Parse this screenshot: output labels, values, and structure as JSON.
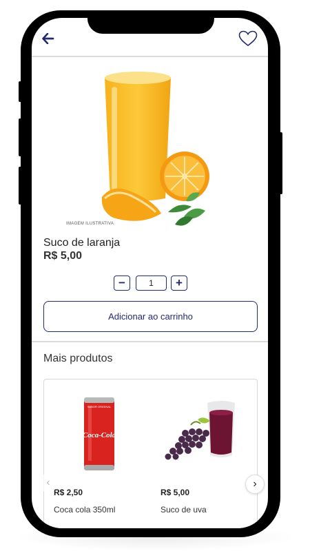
{
  "header": {
    "back_icon": "arrow-left-icon",
    "favorite_icon": "heart-outline-icon",
    "accent_color": "#222a6e"
  },
  "product": {
    "image_caption": "IMAGEM ILUSTRATIVA",
    "name": "Suco de laranja",
    "price": "R$ 5,00"
  },
  "quantity": {
    "minus_label": "−",
    "value": "1",
    "plus_label": "+"
  },
  "add_to_cart_label": "Adicionar ao carrinho",
  "more_products": {
    "title": "Mais produtos",
    "items": [
      {
        "price": "R$ 2,50",
        "name": "Coca cola 350ml",
        "image_text": "Coca-Cola",
        "can_top_text": "SABOR ORIGINAL"
      },
      {
        "price": "R$ 5,00",
        "name": "Suco de uva"
      }
    ],
    "prev_label": "‹",
    "next_label": "›"
  }
}
